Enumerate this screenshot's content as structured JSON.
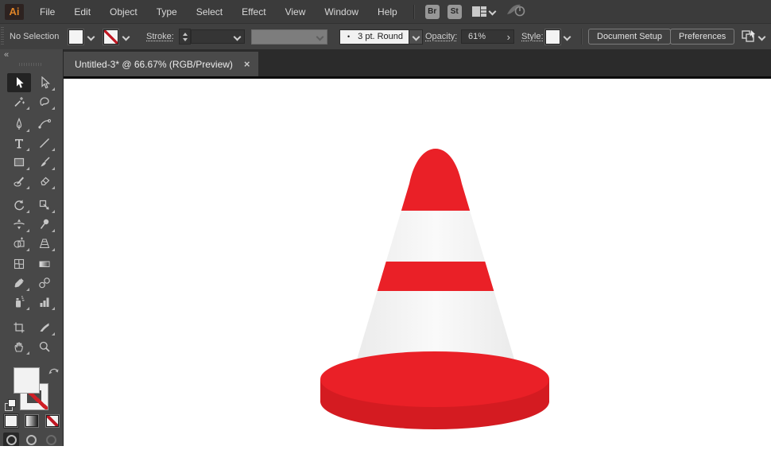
{
  "app": {
    "logo": "Ai"
  },
  "menubar": {
    "items": [
      "File",
      "Edit",
      "Object",
      "Type",
      "Select",
      "Effect",
      "View",
      "Window",
      "Help"
    ],
    "bridge_label": "Br",
    "stock_label": "St"
  },
  "control_bar": {
    "selection_status": "No Selection",
    "stroke_label": "Stroke:",
    "brush_preview_glyph": "•",
    "brush_value": "3 pt. Round",
    "opacity_label": "Opacity:",
    "opacity_value": "61%",
    "opacity_flyout_glyph": "›",
    "style_label": "Style:",
    "document_setup_label": "Document Setup",
    "preferences_label": "Preferences"
  },
  "document_tab": {
    "title": "Untitled-3* @ 66.67% (RGB/Preview)",
    "close_glyph": "×"
  },
  "tools_panel": {
    "collapse_glyph": "«",
    "selected_tool": "selection",
    "tools": [
      "selection",
      "direct-selection",
      "magic-wand",
      "lasso",
      "pen",
      "curvature",
      "type",
      "line-segment",
      "rectangle",
      "paintbrush",
      "shaper",
      "eraser",
      "rotate",
      "scale",
      "width",
      "puppet-warp",
      "shape-builder",
      "perspective-grid",
      "mesh",
      "gradient",
      "eyedropper",
      "blend",
      "symbol-sprayer",
      "column-graph",
      "artboard",
      "slice",
      "hand",
      "zoom"
    ],
    "fill_color": "#f2f2f2",
    "stroke_color": "none"
  },
  "canvas": {
    "artwork_name": "traffic-cone",
    "red": "#ea2027",
    "red_dark": "#d41b21",
    "band_edge": "#eaeaea",
    "band_center": "#fafafa",
    "background": "#ffffff"
  }
}
